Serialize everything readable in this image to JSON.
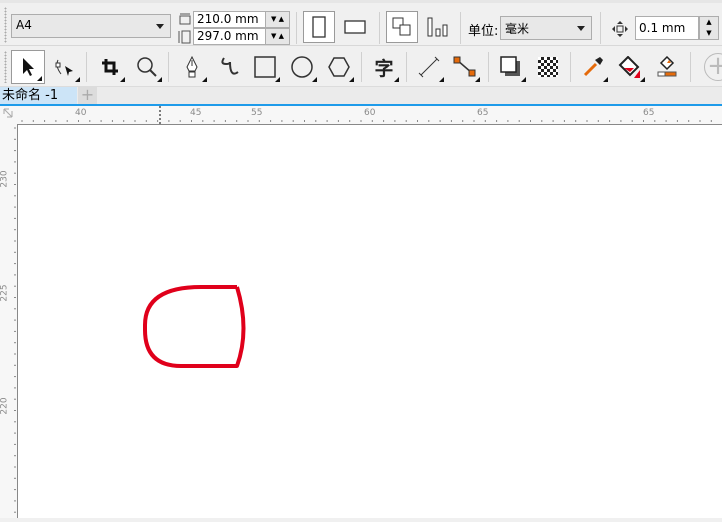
{
  "property_bar": {
    "page_size": "A4",
    "width": "210.0 mm",
    "height": "297.0 mm",
    "units_label": "单位:",
    "units_value": "毫米",
    "nudge": "0.1 mm"
  },
  "toolbox": {
    "tools": [
      "pick-tool",
      "shape-tool",
      "crop-tool",
      "zoom-tool",
      "pen-tool",
      "freehand-tool",
      "rectangle-tool",
      "ellipse-tool",
      "polygon-tool",
      "text-tool",
      "dimension-tool",
      "connector-tool",
      "drop-shadow-tool",
      "transparency-tool",
      "eyedropper-tool",
      "interactive-fill-tool",
      "smart-fill-tool",
      "add-tool"
    ],
    "text_glyph": "字"
  },
  "tabs": [
    {
      "label": "未命名 -1",
      "active": true
    }
  ],
  "ruler": {
    "top_labels": [
      "40",
      "45",
      "55",
      "60",
      "65",
      "65"
    ],
    "left_labels": [
      "230",
      "225",
      "220"
    ]
  },
  "shape": {
    "stroke_color": "#e0001b"
  }
}
